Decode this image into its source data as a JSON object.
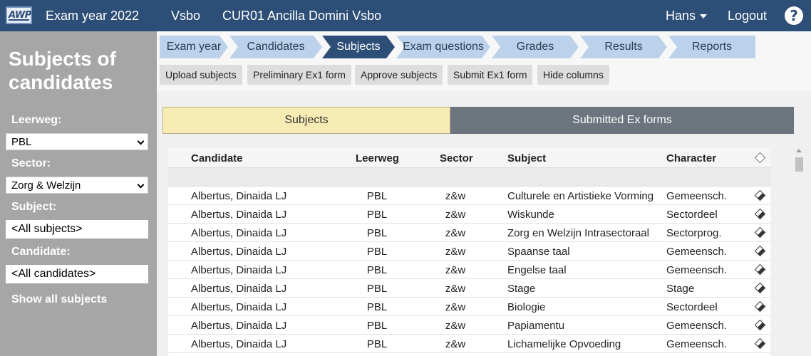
{
  "topbar": {
    "logo_text": "AWP",
    "exam_year": "Exam year 2022",
    "department": "Vsbo",
    "school": "CUR01 Ancilla Domini Vsbo",
    "user": "Hans",
    "logout": "Logout",
    "help": "?"
  },
  "sidebar": {
    "title": "Subjects of candidates",
    "leerweg_label": "Leerweg:",
    "leerweg_value": "PBL",
    "sector_label": "Sector:",
    "sector_value": "Zorg & Welzijn",
    "subject_label": "Subject:",
    "subject_value": "<All subjects>",
    "candidate_label": "Candidate:",
    "candidate_value": "<All candidates>",
    "show_all": "Show all subjects"
  },
  "breadcrumb": [
    {
      "label": "Exam year",
      "active": false
    },
    {
      "label": "Candidates",
      "active": false
    },
    {
      "label": "Subjects",
      "active": true
    },
    {
      "label": "Exam questions",
      "active": false
    },
    {
      "label": "Grades",
      "active": false
    },
    {
      "label": "Results",
      "active": false
    },
    {
      "label": "Reports",
      "active": false
    }
  ],
  "actions": {
    "upload": "Upload subjects",
    "preliminary": "Preliminary Ex1 form",
    "approve": "Approve subjects",
    "submit": "Submit Ex1 form",
    "hide": "Hide columns"
  },
  "tabs": {
    "subjects": "Subjects",
    "submitted": "Submitted Ex forms"
  },
  "table": {
    "headers": {
      "candidate": "Candidate",
      "leerweg": "Leerweg",
      "sector": "Sector",
      "subject": "Subject",
      "character": "Character"
    },
    "rows": [
      {
        "candidate": "Albertus, Dinaida LJ",
        "leerweg": "PBL",
        "sector": "z&w",
        "subject": "Culturele en Artistieke Vorming",
        "character": "Gemeensch."
      },
      {
        "candidate": "Albertus, Dinaida LJ",
        "leerweg": "PBL",
        "sector": "z&w",
        "subject": "Wiskunde",
        "character": "Sectordeel"
      },
      {
        "candidate": "Albertus, Dinaida LJ",
        "leerweg": "PBL",
        "sector": "z&w",
        "subject": "Zorg en Welzijn Intrasectoraal",
        "character": "Sectorprog."
      },
      {
        "candidate": "Albertus, Dinaida LJ",
        "leerweg": "PBL",
        "sector": "z&w",
        "subject": "Spaanse taal",
        "character": "Gemeensch."
      },
      {
        "candidate": "Albertus, Dinaida LJ",
        "leerweg": "PBL",
        "sector": "z&w",
        "subject": "Engelse taal",
        "character": "Gemeensch."
      },
      {
        "candidate": "Albertus, Dinaida LJ",
        "leerweg": "PBL",
        "sector": "z&w",
        "subject": "Stage",
        "character": "Stage"
      },
      {
        "candidate": "Albertus, Dinaida LJ",
        "leerweg": "PBL",
        "sector": "z&w",
        "subject": "Biologie",
        "character": "Sectordeel"
      },
      {
        "candidate": "Albertus, Dinaida LJ",
        "leerweg": "PBL",
        "sector": "z&w",
        "subject": "Papiamentu",
        "character": "Gemeensch."
      },
      {
        "candidate": "Albertus, Dinaida LJ",
        "leerweg": "PBL",
        "sector": "z&w",
        "subject": "Lichamelijke Opvoeding",
        "character": "Gemeensch."
      }
    ]
  },
  "colors": {
    "navbar": "#2d4e77",
    "sidebar": "#a6a6a6",
    "crumb": "#bcd2eb",
    "crumb_active": "#2d4e77",
    "tab_active": "#f8ecb5",
    "tab_inactive": "#6c757d"
  }
}
